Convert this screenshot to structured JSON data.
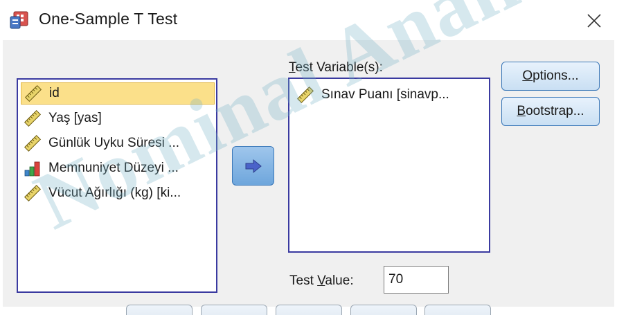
{
  "window": {
    "title": "One-Sample T Test",
    "close_glyph": "✕"
  },
  "source_list": {
    "items": [
      {
        "label": "id",
        "icon": "ruler-scale-icon",
        "selected": true
      },
      {
        "label": "Yaş [yas]",
        "icon": "ruler-scale-icon",
        "selected": false
      },
      {
        "label": "Günlük Uyku Süresi ...",
        "icon": "ruler-scale-icon",
        "selected": false
      },
      {
        "label": "Memnuniyet Düzeyi ...",
        "icon": "ordinal-bars-icon",
        "selected": false
      },
      {
        "label": "Vücut Ağırlığı (kg) [ki...",
        "icon": "ruler-scale-icon",
        "selected": false
      }
    ]
  },
  "move_button": {
    "icon": "move-right-arrow-icon"
  },
  "test_variables": {
    "label_mnemonic": "T",
    "label_rest": "est Variable(s):",
    "items": [
      {
        "label": "Sınav Puanı [sinavp...",
        "icon": "ruler-scale-icon"
      }
    ]
  },
  "buttons": {
    "options_mnemonic": "O",
    "options_rest": "ptions...",
    "bootstrap_mnemonic": "B",
    "bootstrap_rest": "ootstrap..."
  },
  "test_value": {
    "label_pre": "Test ",
    "label_mnemonic": "V",
    "label_post": "alue:",
    "value": "70"
  },
  "watermark": {
    "text": "Nominal Analiz"
  },
  "colors": {
    "selection_bg": "#fbe08a",
    "list_border": "#3a3aa0",
    "button_border": "#3a77b8",
    "arrow_fill": "#4a63c9"
  }
}
